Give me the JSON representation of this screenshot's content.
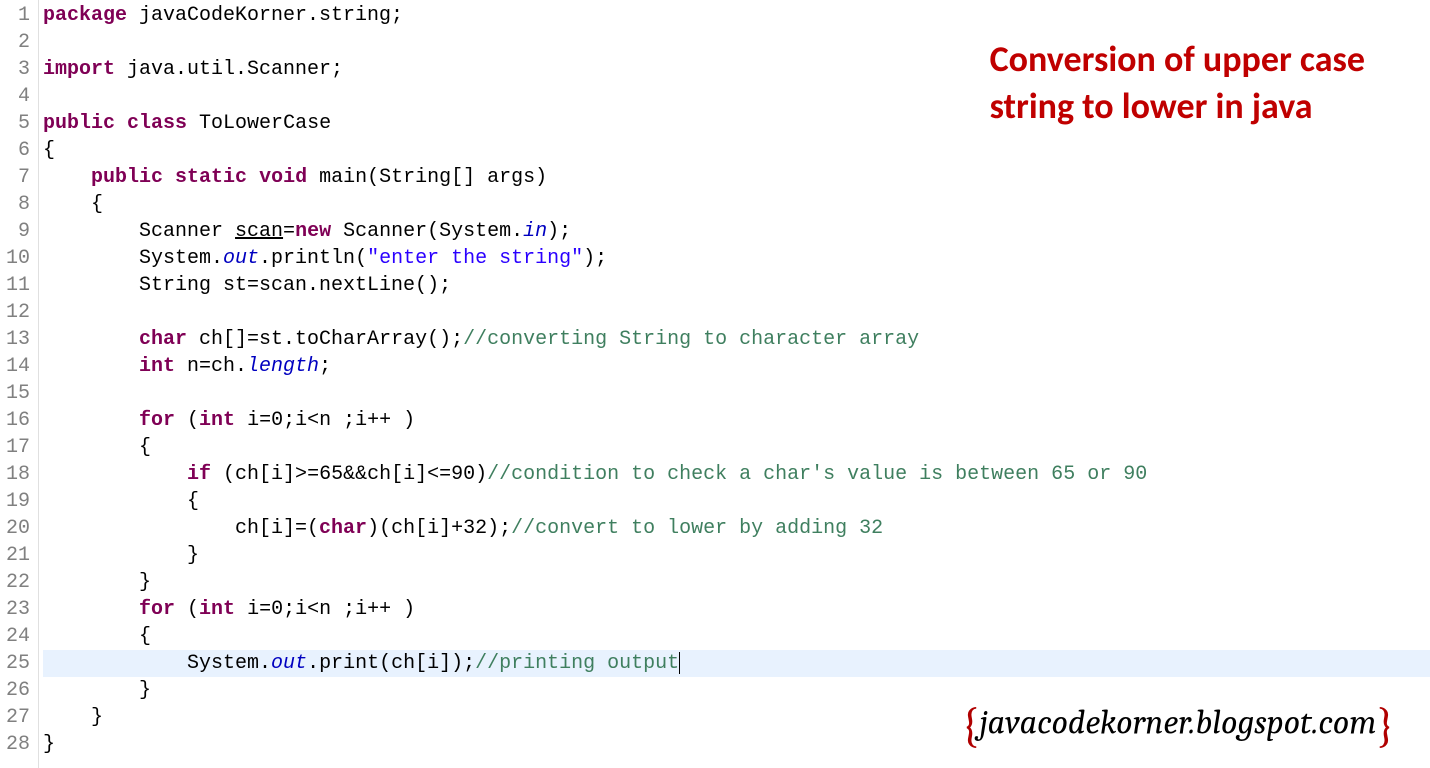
{
  "title": {
    "line1": "Conversion of upper case",
    "line2": "string to lower in java"
  },
  "watermark": {
    "left_brace": "{",
    "text": "javacodekorner.blogspot.com",
    "right_brace": "}"
  },
  "line_numbers": [
    "1",
    "2",
    "3",
    "4",
    "5",
    "6",
    "7",
    "8",
    "9",
    "10",
    "11",
    "12",
    "13",
    "14",
    "15",
    "16",
    "17",
    "18",
    "19",
    "20",
    "21",
    "22",
    "23",
    "24",
    "25",
    "26",
    "27",
    "28"
  ],
  "code": {
    "l1": {
      "kw1": "package",
      "rest": " javaCodeKorner.string;"
    },
    "l3": {
      "kw1": "import",
      "rest": " java.util.Scanner;"
    },
    "l5": {
      "kw1": "public",
      "kw2": "class",
      "rest": " ToLowerCase"
    },
    "l6": "{",
    "l7": {
      "kw1": "public",
      "kw2": "static",
      "kw3": "void",
      "rest": " main(String[] args)"
    },
    "l8": "    {",
    "l9": {
      "p1": "        Scanner ",
      "scan": "scan",
      "p2": "=",
      "kw1": "new",
      "p3": " Scanner(System.",
      "in": "in",
      "p4": ");"
    },
    "l10": {
      "p1": "        System.",
      "out": "out",
      "p2": ".println(",
      "str": "\"enter the string\"",
      "p3": ");"
    },
    "l11": {
      "p1": "        String st=scan.nextLine();"
    },
    "l13": {
      "p1": "        ",
      "kw1": "char",
      "p2": " ch[]=st.toCharArray();",
      "comment": "//converting String to character array"
    },
    "l14": {
      "p1": "        ",
      "kw1": "int",
      "p2": " n=ch.",
      "len": "length",
      "p3": ";"
    },
    "l16": {
      "p1": "        ",
      "kw1": "for",
      "p2": " (",
      "kw2": "int",
      "p3": " i=0;i<n ;i++ )"
    },
    "l17": "        {",
    "l18": {
      "p1": "            ",
      "kw1": "if",
      "p2": " (ch[i]>=65&&ch[i]<=90)",
      "comment": "//condition to check a char's value is between 65 or 90"
    },
    "l19": "            {",
    "l20": {
      "p1": "                ch[i]=(",
      "kw1": "char",
      "p2": ")(ch[i]+32);",
      "comment": "//convert to lower by adding 32"
    },
    "l21": "            }",
    "l22": "        }",
    "l23": {
      "p1": "        ",
      "kw1": "for",
      "p2": " (",
      "kw2": "int",
      "p3": " i=0;i<n ;i++ )"
    },
    "l24": "        {",
    "l25": {
      "p1": "            System.",
      "out": "out",
      "p2": ".print(ch[i]);",
      "comment": "//printing output"
    },
    "l26": "        }",
    "l27": "    }",
    "l28": "}"
  }
}
